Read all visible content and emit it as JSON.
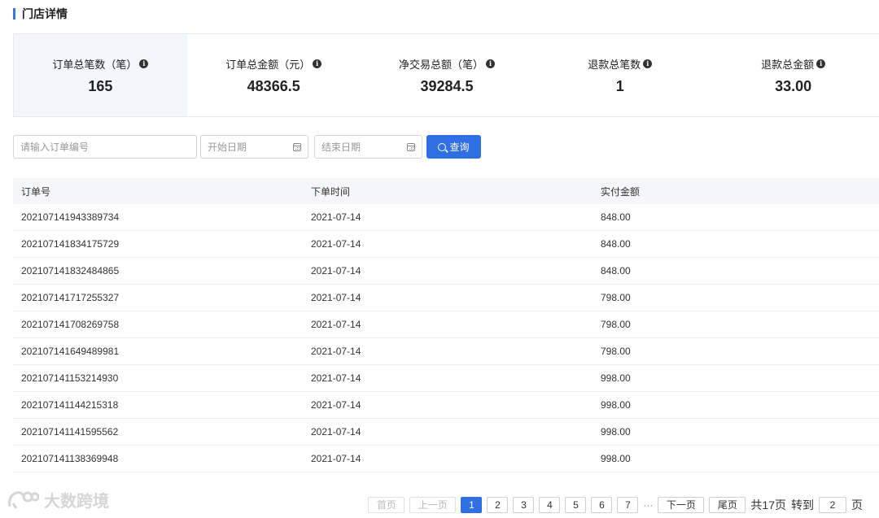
{
  "header": {
    "title": "门店详情",
    "accent_color": "#3a74e0"
  },
  "stats": [
    {
      "label": "订单总笔数（笔）",
      "value": "165",
      "info_icon": "info-icon"
    },
    {
      "label": "订单总金额（元）",
      "value": "48366.5",
      "info_icon": "info-icon"
    },
    {
      "label": "净交易总额（笔）",
      "value": "39284.5",
      "info_icon": "info-icon"
    },
    {
      "label": "退款总笔数",
      "value": "1",
      "info_icon": "info-icon"
    },
    {
      "label": "退款总金额",
      "value": "33.00",
      "info_icon": "info-icon"
    }
  ],
  "filters": {
    "order_placeholder": "请输入订单编号",
    "start_date_placeholder": "开始日期",
    "end_date_placeholder": "结束日期",
    "search_label": "查询",
    "button_color": "#2f6ee3"
  },
  "table": {
    "columns": [
      "订单号",
      "下单时间",
      "实付金额"
    ],
    "rows": [
      [
        "202107141943389734",
        "2021-07-14",
        "848.00"
      ],
      [
        "202107141834175729",
        "2021-07-14",
        "848.00"
      ],
      [
        "202107141832484865",
        "2021-07-14",
        "848.00"
      ],
      [
        "202107141717255327",
        "2021-07-14",
        "798.00"
      ],
      [
        "202107141708269758",
        "2021-07-14",
        "798.00"
      ],
      [
        "202107141649489981",
        "2021-07-14",
        "798.00"
      ],
      [
        "202107141153214930",
        "2021-07-14",
        "998.00"
      ],
      [
        "202107141144215318",
        "2021-07-14",
        "998.00"
      ],
      [
        "202107141141595562",
        "2021-07-14",
        "998.00"
      ],
      [
        "202107141138369948",
        "2021-07-14",
        "998.00"
      ]
    ]
  },
  "pagination": {
    "first": "首页",
    "prev": "上一页",
    "pages": [
      "1",
      "2",
      "3",
      "4",
      "5",
      "6",
      "7"
    ],
    "current_page": "1",
    "ellipsis": "···",
    "next": "下一页",
    "last": "尾页",
    "total": "共17页",
    "goto_label": "转到",
    "goto_value": "2",
    "goto_suffix": "页"
  },
  "watermark": {
    "text": "大数跨境"
  }
}
